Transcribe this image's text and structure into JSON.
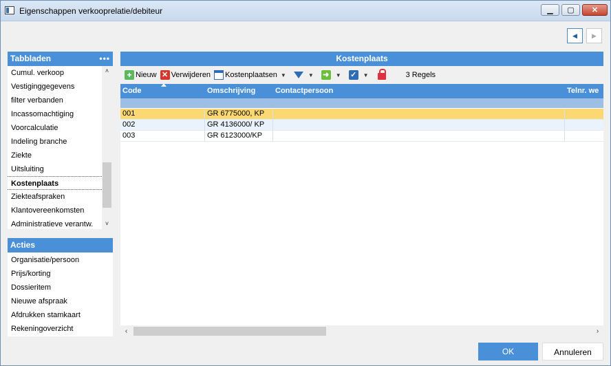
{
  "window": {
    "title": "Eigenschappen verkooprelatie/debiteur"
  },
  "tabbladen": {
    "header": "Tabbladen",
    "more": "•••",
    "items": [
      "Cumul. verkoop",
      "Vestiginggegevens",
      "filter verbanden",
      "Incassomachtiging",
      "Voorcalculatie",
      "Indeling branche",
      "Ziekte",
      "Uitsluiting",
      "Kostenplaats",
      "Ziekteafspraken",
      "Klantovereenkomsten",
      "Administratieve verantw."
    ],
    "active": "Kostenplaats"
  },
  "acties": {
    "header": "Acties",
    "items": [
      "Organisatie/persoon",
      "Prijs/korting",
      "Dossieritem",
      "Nieuwe afspraak",
      "Afdrukken stamkaart",
      "Rekeningoverzicht"
    ]
  },
  "main": {
    "header": "Kostenplaats",
    "toolbar": {
      "new": "Nieuw",
      "delete": "Verwijderen",
      "cost_centers": "Kostenplaatsen",
      "count": "3 Regels"
    },
    "columns": [
      "Code",
      "Omschrijving",
      "Contactpersoon",
      "Telnr. we"
    ],
    "rows": [
      {
        "code": "001",
        "omschrijving": "GR 6775000, KP",
        "contactpersoon": "",
        "telnr": ""
      },
      {
        "code": "002",
        "omschrijving": "GR 4136000/ KP",
        "contactpersoon": "",
        "telnr": ""
      },
      {
        "code": "003",
        "omschrijving": "GR 6123000/KP",
        "contactpersoon": "",
        "telnr": ""
      }
    ]
  },
  "buttons": {
    "ok": "OK",
    "cancel": "Annuleren"
  },
  "colors": {
    "accent": "#4a90d9",
    "selected_row": "#fcd872"
  }
}
